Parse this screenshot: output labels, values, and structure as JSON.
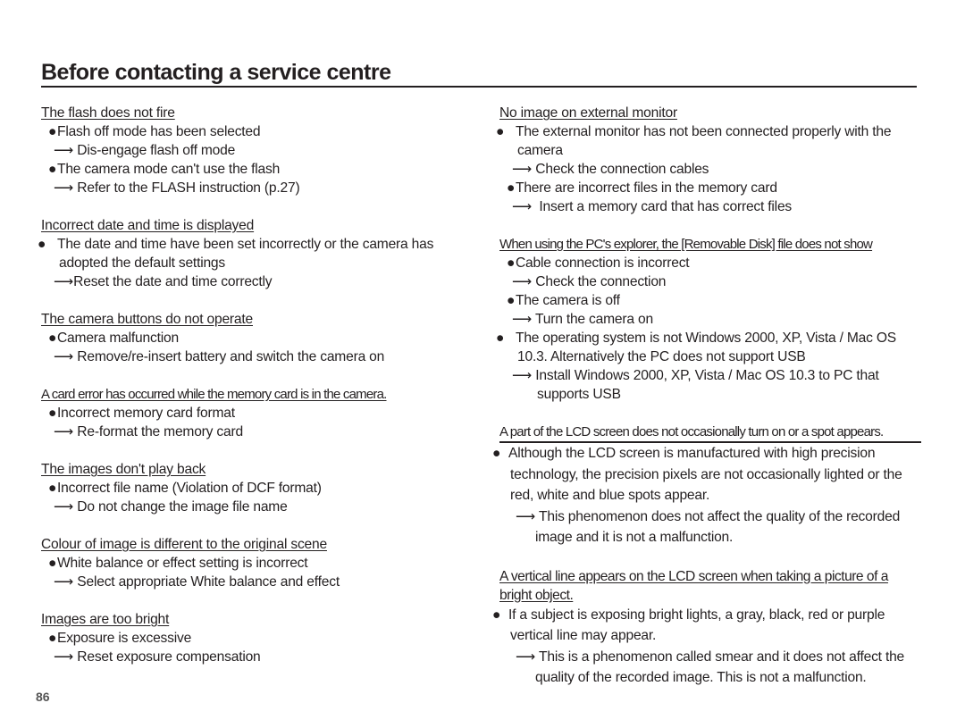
{
  "page": {
    "title": "Before contacting a service centre",
    "page_number": "86"
  },
  "left_sections": [
    {
      "heading": "The flash does not fire",
      "items": [
        {
          "cause": "Flash off mode has been selected",
          "fix": "Dis-engage flash off mode"
        },
        {
          "cause": "The camera mode can't use the flash",
          "fix": "Refer to the FLASH instruction (p.27)"
        }
      ]
    },
    {
      "heading": "Incorrect date and time is displayed",
      "items": [
        {
          "cause": "The date and time have been set incorrectly or the camera has adopted the default settings",
          "fix": "Reset the date and time correctly"
        }
      ]
    },
    {
      "heading": "The camera buttons do not operate",
      "items": [
        {
          "cause": "Camera malfunction",
          "fix": "Remove/re-insert battery and switch the camera on"
        }
      ]
    },
    {
      "heading": "A card error has occurred while the memory card is in the camera.",
      "items": [
        {
          "cause": "Incorrect memory card format",
          "fix": "Re-format the memory card"
        }
      ]
    },
    {
      "heading": "The images don't play back",
      "items": [
        {
          "cause": "Incorrect file name (Violation of DCF format)",
          "fix": "Do not change the image file name"
        }
      ]
    },
    {
      "heading": "Colour of image is different to the original scene",
      "items": [
        {
          "cause": "White balance or effect setting is incorrect",
          "fix": "Select appropriate White balance and effect"
        }
      ]
    },
    {
      "heading": "Images are too bright",
      "items": [
        {
          "cause": "Exposure is excessive",
          "fix": "Reset exposure compensation"
        }
      ]
    }
  ],
  "right_sections": [
    {
      "heading": "No image on external monitor",
      "items": [
        {
          "cause": "The external monitor has not been connected properly with the camera",
          "fix": "Check the connection cables"
        },
        {
          "cause": "There are incorrect files in the memory card",
          "fix": "Insert a memory card that has correct files"
        }
      ]
    },
    {
      "heading": "When using the PC's explorer, the [Removable Disk] file does not show",
      "items": [
        {
          "cause": "Cable connection is incorrect",
          "fix": "Check the connection"
        },
        {
          "cause": "The camera is off",
          "fix": "Turn the camera on"
        },
        {
          "cause": "The operating system is not Windows 2000, XP, Vista / Mac OS 10.3. Alternatively the PC does not support USB",
          "fix": "Install Windows 2000, XP, Vista / Mac OS 10.3 to PC that supports USB"
        }
      ]
    },
    {
      "heading": "A part of the LCD screen does not occasionally turn on or a spot appears.",
      "items": [
        {
          "cause": "Although the LCD screen is manufactured with high precision technology, the precision pixels are not occasionally lighted or the red, white and blue spots appear.",
          "fix": "This phenomenon does not affect the quality of the recorded image and it is not a malfunction."
        }
      ]
    },
    {
      "heading": "A vertical line appears on the LCD screen when taking a picture of a bright object.",
      "items": [
        {
          "cause": "If a subject is exposing bright lights, a gray, black, red or purple vertical line may appear.",
          "fix": "This is a phenomenon called smear and it does not affect the quality of the recorded image. This is not a malfunction."
        }
      ]
    }
  ],
  "glyphs": {
    "bullet": "●",
    "arrow": "⟶"
  }
}
